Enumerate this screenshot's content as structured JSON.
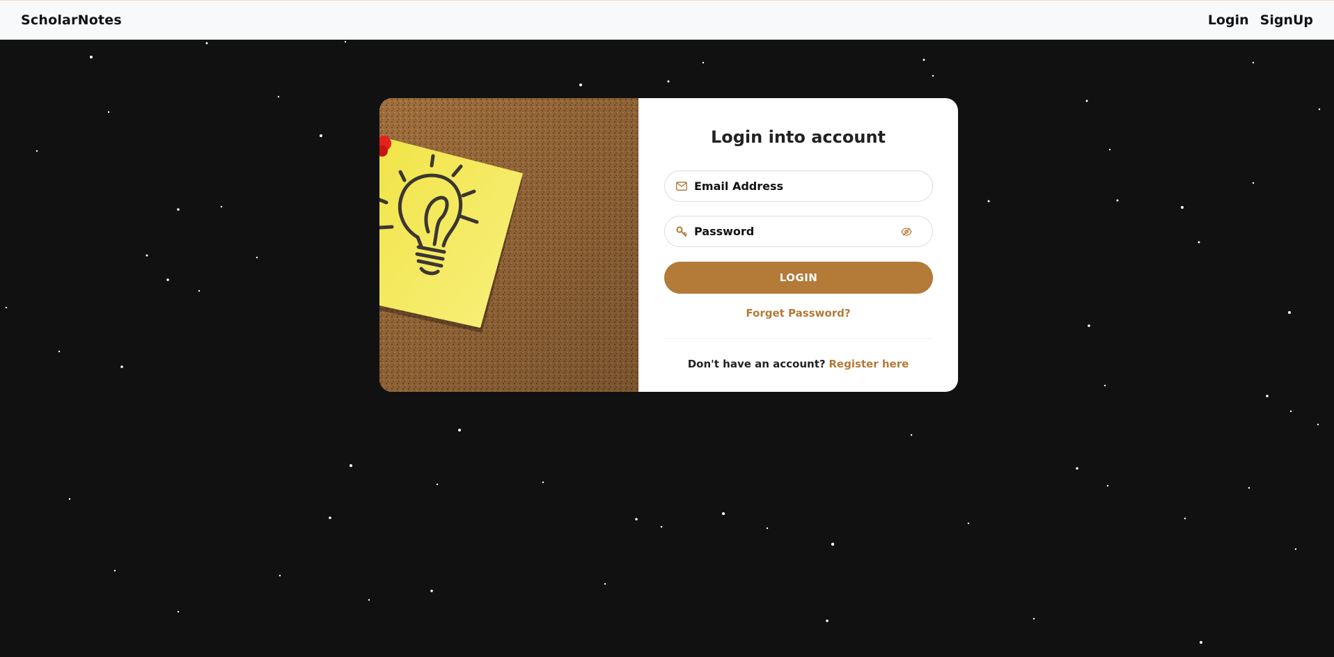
{
  "navbar": {
    "brand": "ScholarNotes",
    "links": [
      "Login",
      "SignUp"
    ]
  },
  "login": {
    "title": "Login into account",
    "email_placeholder": "Email Address",
    "email_icon": "envelope-icon",
    "password_placeholder": "Password",
    "password_icon": "key-icon",
    "toggle_icon": "eye-slash-icon",
    "button_label": "LOGIN",
    "forgot_label": "Forget Password?",
    "register_prompt": "Don't have an account?",
    "register_link": "Register here"
  },
  "illustration": {
    "description_icon": "lightbulb-sticky-note-icon"
  },
  "colors": {
    "accent": "#b37a38",
    "background": "#111111",
    "navbar": "#f8f9fa"
  }
}
